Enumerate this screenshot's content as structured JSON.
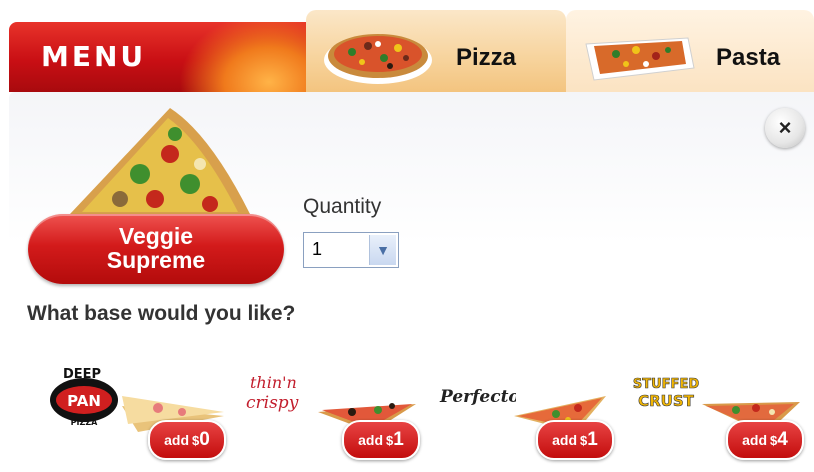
{
  "header": {
    "menu_label": "MENU",
    "tabs": [
      {
        "label": "Pizza",
        "icon": "pizza-icon"
      },
      {
        "label": "Pasta",
        "icon": "pasta-dish-icon"
      }
    ]
  },
  "product": {
    "name_line1": "Veggie",
    "name_line2": "Supreme"
  },
  "quantity": {
    "label": "Quantity",
    "value": "1"
  },
  "base_question": "What base would you like?",
  "bases": [
    {
      "logo_line1": "DEEP",
      "logo_line2": "PAN",
      "logo_line3": "PIZZA",
      "add_word": "add",
      "currency": "$",
      "price": "0"
    },
    {
      "logo_line1": "thin'n",
      "logo_line2": "crispy",
      "add_word": "add",
      "currency": "$",
      "price": "1"
    },
    {
      "logo_line1": "Perfecto",
      "add_word": "add",
      "currency": "$",
      "price": "1"
    },
    {
      "logo_line1": "STUFFED",
      "logo_line2": "CRUST",
      "add_word": "add",
      "currency": "$",
      "price": "4"
    }
  ],
  "close_glyph": "×",
  "colors": {
    "accent_red": "#c90f14",
    "tab_bg": "#f7d39c"
  }
}
